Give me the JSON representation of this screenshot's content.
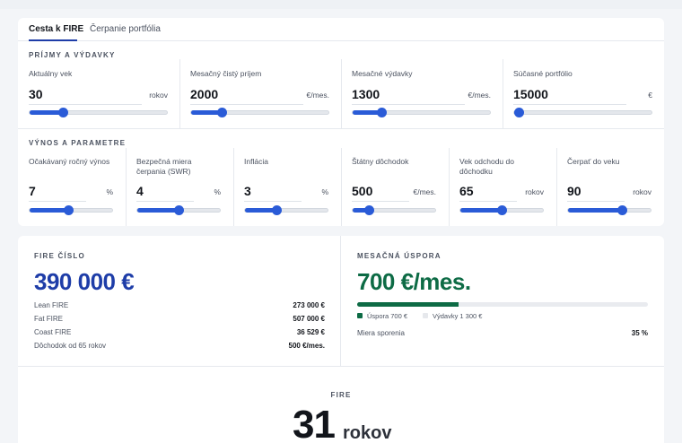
{
  "tabs": [
    {
      "label": "Cesta k FIRE",
      "active": true
    },
    {
      "label": "Čerpanie portfólia",
      "active": false
    }
  ],
  "income_section": {
    "title": "PRÍJMY A VÝDAVKY",
    "fields": [
      {
        "label": "Aktuálny vek",
        "value": "30",
        "unit": "rokov",
        "slider_fraction": 0.24
      },
      {
        "label": "Mesačný čistý príjem",
        "value": "2000",
        "unit": "€/mes.",
        "slider_fraction": 0.22
      },
      {
        "label": "Mesačné výdavky",
        "value": "1300",
        "unit": "€/mes.",
        "slider_fraction": 0.21
      },
      {
        "label": "Súčasné portfólio",
        "value": "15000",
        "unit": "€",
        "slider_fraction": 0.03
      }
    ]
  },
  "return_section": {
    "title": "VÝNOS A PARAMETRE",
    "fields": [
      {
        "label": "Očakávaný ročný výnos",
        "value": "7",
        "unit": "%",
        "slider_fraction": 0.47
      },
      {
        "label": "Bezpečná miera čerpania (SWR)",
        "value": "4",
        "unit": "%",
        "slider_fraction": 0.5
      },
      {
        "label": "Inflácia",
        "value": "3",
        "unit": "%",
        "slider_fraction": 0.38
      },
      {
        "label": "Štátny dôchodok",
        "value": "500",
        "unit": "€/mes.",
        "slider_fraction": 0.2
      },
      {
        "label": "Vek odchodu do dôchodku",
        "value": "65",
        "unit": "rokov",
        "slider_fraction": 0.5
      },
      {
        "label": "Čerpať do veku",
        "value": "90",
        "unit": "rokov",
        "slider_fraction": 0.65
      }
    ]
  },
  "fire_number": {
    "title": "FIRE ČÍSLO",
    "value": "390 000 €",
    "color": "#1e3da8",
    "rows": [
      {
        "label": "Lean FIRE",
        "value": "273 000 €"
      },
      {
        "label": "Fat FIRE",
        "value": "507 000 €"
      },
      {
        "label": "Coast FIRE",
        "value": "36 529 €"
      },
      {
        "label": "Dôchodok od 65 rokov",
        "value": "500 €/mes."
      }
    ]
  },
  "monthly_savings": {
    "title": "MESAČNÁ ÚSPORA",
    "value": "700 €/mes.",
    "color": "#0d6b45",
    "progress_fraction": 0.35,
    "legend_savings": "Úspora 700 €",
    "legend_expenses": "Výdavky 1 300 €",
    "rate_label": "Miera sporenia",
    "rate_value": "35 %"
  },
  "fire_age": {
    "title": "FIRE",
    "value": "31",
    "unit": "rokov"
  }
}
